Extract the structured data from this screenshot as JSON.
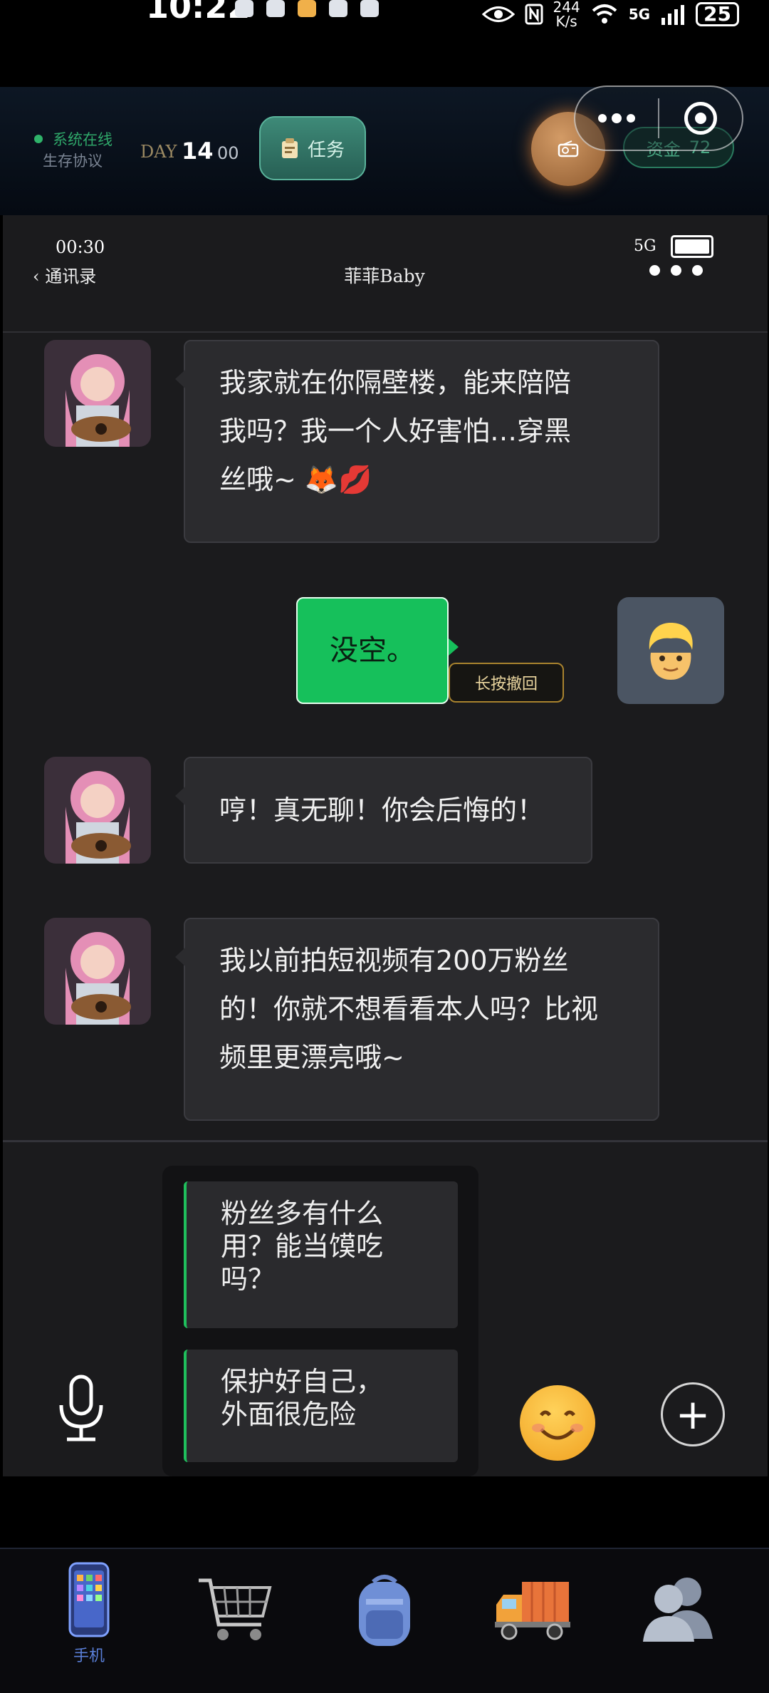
{
  "status_bar": {
    "time": "10:22",
    "net_speed_value": "244",
    "net_speed_unit": "K/s",
    "network": "5G",
    "battery": "25"
  },
  "game_header": {
    "system_online": "系统在线",
    "protocol": "生存协议",
    "day_label": "DAY",
    "day_number": "14",
    "day_sub": "00",
    "task_label": "任务",
    "funds_label": "资金",
    "funds_value": "72"
  },
  "phone": {
    "time": "00:30",
    "network": "5G",
    "back_label": "通讯录",
    "contact_name": "菲菲Baby"
  },
  "messages": [
    {
      "from": "contact",
      "text_lines": [
        "我家就在你隔壁楼，能来陪陪",
        "我吗？我一个人好害怕…穿黑",
        "丝哦~ 🦊💋"
      ]
    },
    {
      "from": "me",
      "text": "没空。",
      "recall_label": "长按撤回"
    },
    {
      "from": "contact",
      "text": "哼！真无聊！你会后悔的！"
    },
    {
      "from": "contact",
      "text_lines": [
        "我以前拍短视频有200万粉丝",
        "的！你就不想看看本人吗？比视",
        "频里更漂亮哦~"
      ]
    }
  ],
  "reply_options": [
    {
      "lines": [
        "粉丝多有什么",
        "用？能当馍吃",
        "吗？"
      ]
    },
    {
      "lines": [
        "保护好自己，",
        "外面很危险"
      ]
    }
  ],
  "bottom_nav": [
    {
      "name": "phone",
      "label": "手机",
      "active": true
    },
    {
      "name": "shop",
      "label": "",
      "active": false
    },
    {
      "name": "backpack",
      "label": "",
      "active": false
    },
    {
      "name": "truck",
      "label": "",
      "active": false
    },
    {
      "name": "contacts",
      "label": "",
      "active": false
    }
  ],
  "colors": {
    "accent_green": "#16c05b",
    "nav_active": "#5a7fd8",
    "bubble_in": "#2b2b2e"
  }
}
